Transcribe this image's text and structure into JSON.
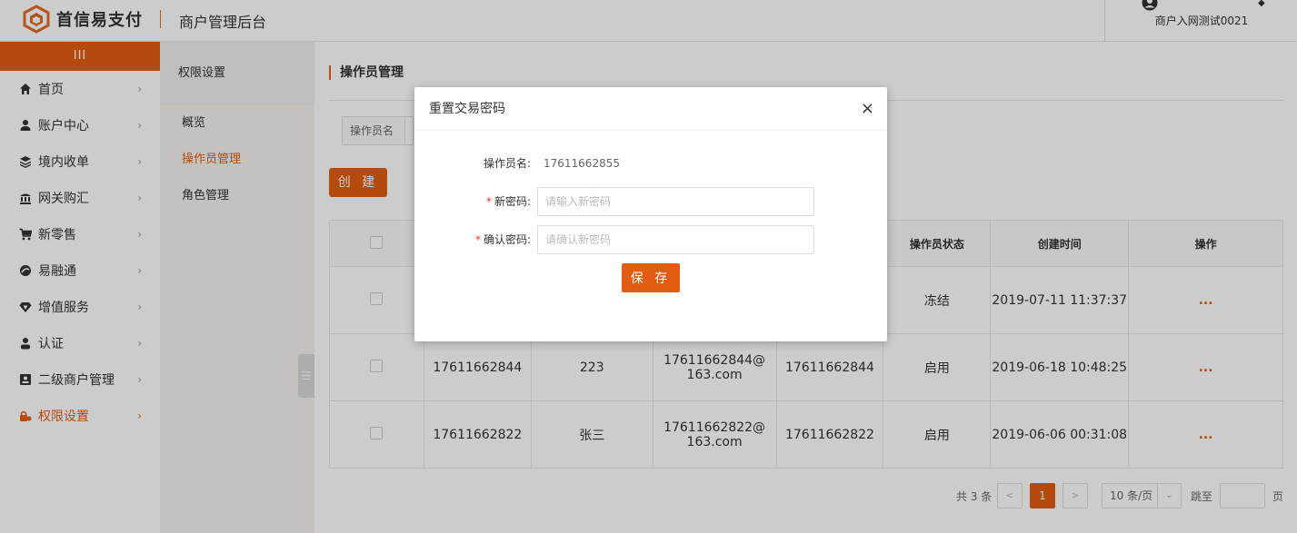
{
  "header": {
    "brand": "首信易支付",
    "console_title": "商户管理后台",
    "user_name": "商户入网测试0021"
  },
  "sidebar": {
    "toggle": "III",
    "items": [
      {
        "label": "首页",
        "icon": "home-icon"
      },
      {
        "label": "账户中心",
        "icon": "user-icon"
      },
      {
        "label": "境内收单",
        "icon": "layers-icon"
      },
      {
        "label": "网关购汇",
        "icon": "bank-icon"
      },
      {
        "label": "新零售",
        "icon": "cart-icon"
      },
      {
        "label": "易融通",
        "icon": "swirl-icon"
      },
      {
        "label": "增值服务",
        "icon": "gem-icon"
      },
      {
        "label": "认证",
        "icon": "person-icon"
      },
      {
        "label": "二级商户管理",
        "icon": "id-card-icon"
      },
      {
        "label": "权限设置",
        "icon": "lock-icon"
      }
    ]
  },
  "submenu": {
    "title": "权限设置",
    "items": [
      "概览",
      "操作员管理",
      "角色管理"
    ]
  },
  "main": {
    "title": "操作员管理",
    "filter_label": "操作员名",
    "create_label": "创 建",
    "table": {
      "headers": [
        "",
        "",
        "",
        "",
        "",
        "操作员状态",
        "创建时间",
        "操作"
      ],
      "rows": [
        {
          "c1": "",
          "c2": "",
          "c3": "",
          "c4": "",
          "status": "冻结",
          "time": "2019-07-11 11:37:37",
          "op": "..."
        },
        {
          "c1": "17611662844",
          "c2": "223",
          "c3": "17611662844@163.com",
          "c4": "17611662844",
          "status": "启用",
          "time": "2019-06-18 10:48:25",
          "op": "..."
        },
        {
          "c1": "17611662822",
          "c2": "张三",
          "c3": "17611662822@163.com",
          "c4": "17611662822",
          "status": "启用",
          "time": "2019-06-06 00:31:08",
          "op": "..."
        }
      ]
    },
    "pager": {
      "total": "共 3 条",
      "prev": "<",
      "current": "1",
      "next": ">",
      "size": "10 条/页",
      "jump": "跳至",
      "unit": "页"
    }
  },
  "modal": {
    "title": "重置交易密码",
    "close": "×",
    "operator_label": "操作员名:",
    "operator_value": "17611662855",
    "new_pw_label": "新密码:",
    "new_pw_placeholder": "请输入新密码",
    "confirm_pw_label": "确认密码:",
    "confirm_pw_placeholder": "请确认新密码",
    "required_mark": "*",
    "save_label": "保 存"
  },
  "colors": {
    "accent": "#e25d12",
    "required": "#e0341b"
  }
}
